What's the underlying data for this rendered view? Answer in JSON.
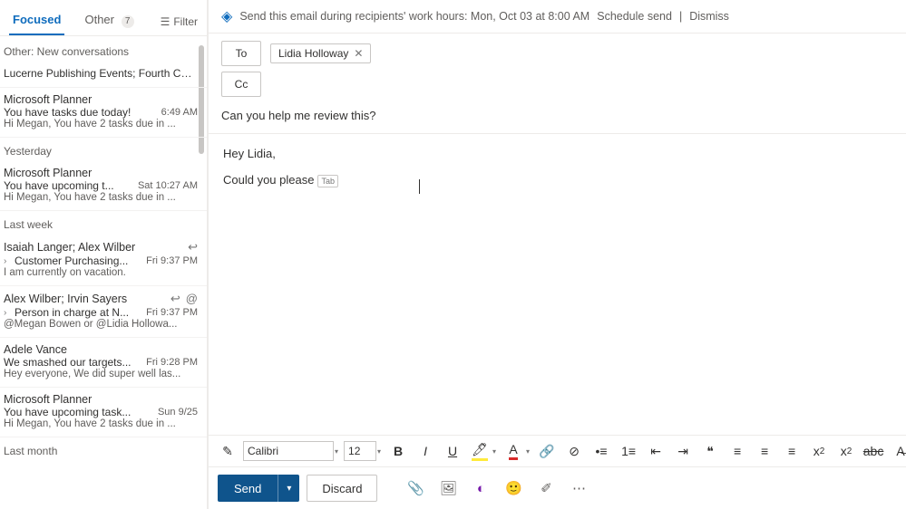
{
  "sidebar": {
    "tabs": {
      "focused": "Focused",
      "other": "Other",
      "other_badge": "7",
      "filter": "Filter"
    },
    "sections": {
      "other_new": "Other: New conversations",
      "yesterday": "Yesterday",
      "last_week": "Last week",
      "last_month": "Last month"
    },
    "items": [
      {
        "subj": "Lucerne Publishing Events; Fourth Coffe..."
      },
      {
        "from": "Microsoft Planner",
        "subj": "You have tasks due today!",
        "ts": "6:49 AM",
        "prev": "Hi Megan, You have 2 tasks due in ..."
      },
      {
        "from": "Microsoft Planner",
        "subj": "You have upcoming t...",
        "ts": "Sat 10:27 AM",
        "prev": "Hi Megan, You have 2 tasks due in ..."
      },
      {
        "from": "Isaiah Langer; Alex Wilber",
        "subj": "Customer Purchasing...",
        "ts": "Fri 9:37 PM",
        "prev": "I am currently on vacation."
      },
      {
        "from": "Alex Wilber; Irvin Sayers",
        "subj": "Person in charge at N...",
        "ts": "Fri 9:37 PM",
        "prev": "@Megan Bowen or @Lidia Hollowa..."
      },
      {
        "from": "Adele Vance",
        "subj": "We smashed our targets...",
        "ts": "Fri 9:28 PM",
        "prev": "Hey everyone, We did super well las..."
      },
      {
        "from": "Microsoft Planner",
        "subj": "You have upcoming task...",
        "ts": "Sun 9/25",
        "prev": "Hi Megan, You have 2 tasks due in ..."
      }
    ]
  },
  "tip": {
    "text": "Send this email during recipients' work hours: Mon, Oct 03 at 8:00 AM",
    "schedule": "Schedule send",
    "dismiss": "Dismiss"
  },
  "compose": {
    "to_label": "To",
    "cc_label": "Cc",
    "to_chip": "Lidia Holloway",
    "subject": "Can you help me review this?",
    "body_greeting": "Hey Lidia,",
    "body_line": "Could you please",
    "tab_hint": "Tab"
  },
  "fmt": {
    "font": "Calibri",
    "size": "12"
  },
  "actions": {
    "send": "Send",
    "discard": "Discard"
  }
}
